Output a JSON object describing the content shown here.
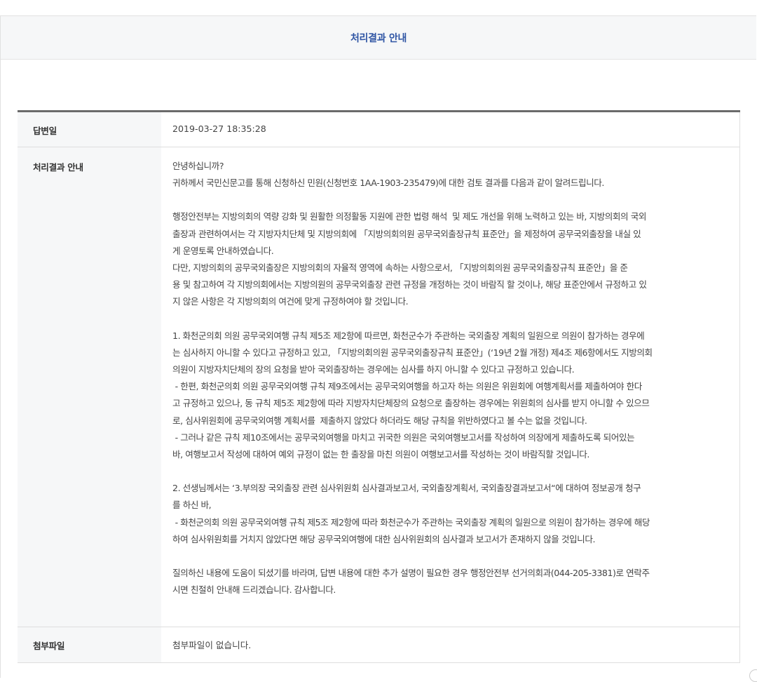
{
  "header": {
    "title": "처리결과 안내"
  },
  "table": {
    "rows": {
      "date": {
        "label": "답변일",
        "value": "2019-03-27 18:35:28"
      },
      "result": {
        "label": "처리결과 안내",
        "paragraphs": [
          "안녕하십니까?\n귀하께서 국민신문고를 통해 신청하신 민원(신청번호 1AA-1903-235479)에 대한 검토 결과를 다음과 같이 알려드립니다.",
          "행정안전부는 지방의회의 역량 강화 및 원활한 의정활동 지원에 관한 법령 해석  및 제도 개선을 위해 노력하고 있는 바, 지방의회의 국외\n출장과 관련하여서는 각 지방자치단체 및 지방의회에 「지방의회의원 공무국외출장규칙 표준안」을 제정하여 공무국외출장을 내실 있\n게 운영토록 안내하였습니다.\n다만, 지방의회의 공무국외출장은 지방의회의 자율적 영역에 속하는 사항으로서, 「지방의회의원 공무국외출장규칙 표준안」을 준\n용 및 참고하여 각 지방의회에서는 지방의원의 공무국외출장 관련 규정을 개정하는 것이 바람직 할 것이나, 해당 표준안에서 규정하고 있\n지 않은 사항은 각 지방의회의 여건에 맞게 규정하여야 할 것입니다.",
          "1. 화천군의회 의원 공무국외여행 규칙 제5조 제2항에 따르면, 화천군수가 주관하는 국외출장 계획의 일원으로 의원이 참가하는 경우에\n는 심사하지 아니할 수 있다고 규정하고 있고, 「지방의회의원 공무국외출장규칙 표준안」(‘19년 2월 개정) 제4조 제6항에서도 지방의회\n의원이 지방자치단체의 장의 요청을 받아 국외출장하는 경우에는 심사를 하지 아니할 수 있다고 규정하고 있습니다.\n - 한편, 화천군의회 의원 공무국외여행 규칙 제9조에서는 공무국외여행을 하고자 하는 의원은 위원회에 여행계획서를 제출하여야 한다\n고 규정하고 있으나, 동 규칙 제5조 제2항에 따라 지방자치단체장의 요청으로 출장하는 경우에는 위원회의 심사를 받지 아니할 수 있으므\n로, 심사위원회에 공무국외여행 계획서를  제출하지 않았다 하더라도 해당 규칙을 위반하였다고 볼 수는 없을 것입니다.\n - 그러나 같은 규칙 제10조에서는 공무국외여행을 마치고 귀국한 의원은 국외여행보고서를 작성하여 의장에게 제출하도록 되어있는\n바, 여행보고서 작성에 대하여 예외 규정이 없는 한 출장을 마친 의원이 여행보고서를 작성하는 것이 바람직할 것입니다.",
          "2. 선생님께서는 ‘3.부의장 국외출장 관련 심사위원회 심사결과보고서, 국외출장계획서, 국외출장결과보고서“에 대하여 정보공개 청구\n를 하신 바,\n - 화천군의회 의원 공무국외여행 규칙 제5조 제2항에 따라 화천군수가 주관하는 국외출장 계획의 일원으로 의원이 참가하는 경우에 해당\n하여 심사위원회를 거치지 않았다면 해당 공무국외여행에 대한 심사위원회의 심사결과 보고서가 존재하지 않을 것입니다.",
          "질의하신 내용에 도움이 되셨기를 바라며, 답변 내용에 대한 추가 설명이 필요한 경우 행정안전부 선거의회과(044-205-3381)로 연락주\n시면 친절히 안내해 드리겠습니다. 감사합니다."
        ]
      },
      "attachment": {
        "label": "첨부파일",
        "value": "첨부파일이 없습니다."
      }
    }
  }
}
